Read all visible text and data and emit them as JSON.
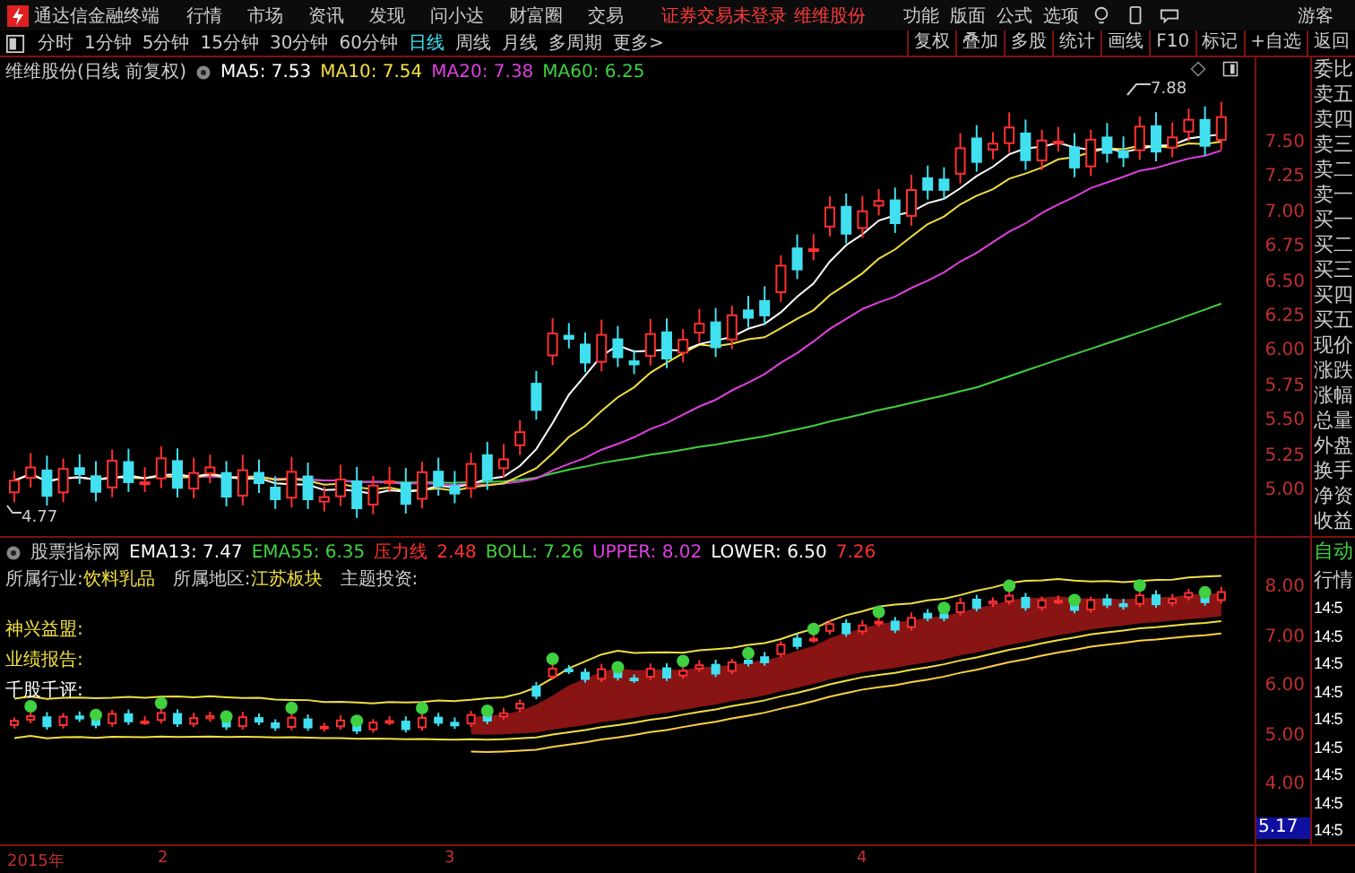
{
  "menu_bar": {
    "app_title": "通达信金融终端",
    "menus": [
      "行情",
      "市场",
      "资讯",
      "发现",
      "问小达",
      "财富圈",
      "交易"
    ],
    "login_status": "证券交易未登录",
    "account_name": "维维股份",
    "right_menus": [
      "功能",
      "版面",
      "公式",
      "选项"
    ],
    "user": "游客"
  },
  "period_tabs": [
    {
      "label": "分时",
      "selected": false
    },
    {
      "label": "1分钟",
      "selected": false
    },
    {
      "label": "5分钟",
      "selected": false
    },
    {
      "label": "15分钟",
      "selected": false
    },
    {
      "label": "30分钟",
      "selected": false
    },
    {
      "label": "60分钟",
      "selected": false
    },
    {
      "label": "日线",
      "selected": true
    },
    {
      "label": "周线",
      "selected": false
    },
    {
      "label": "月线",
      "selected": false
    },
    {
      "label": "多周期",
      "selected": false
    },
    {
      "label": "更多>",
      "selected": false
    }
  ],
  "tool_buttons": [
    "复权",
    "叠加",
    "多股",
    "统计",
    "画线",
    "F10",
    "标记",
    "+自选",
    "返回"
  ],
  "main_chart": {
    "title": "维维股份(日线 前复权)",
    "indicators": [
      {
        "text": "MA5: 7.53",
        "color": "#ffffff"
      },
      {
        "text": "MA10: 7.54",
        "color": "#f0e040"
      },
      {
        "text": "MA20: 7.38",
        "color": "#e040e0"
      },
      {
        "text": "MA60: 6.25",
        "color": "#40d040"
      }
    ],
    "price_ticks": [
      "7.50",
      "7.25",
      "7.00",
      "6.75",
      "6.50",
      "6.25",
      "6.00",
      "5.75",
      "5.50",
      "5.25",
      "5.00"
    ],
    "high_label": "7.88",
    "low_label": "4.77"
  },
  "indicator_pane": {
    "title": "股票指标网",
    "values": [
      {
        "text": "EMA13: 7.47",
        "color": "#ffffff"
      },
      {
        "text": "EMA55: 6.35",
        "color": "#40d040"
      },
      {
        "text": "压力线",
        "color": "#ff3030"
      },
      {
        "text": "2.48",
        "color": "#ff3030"
      },
      {
        "text": "BOLL: 7.26",
        "color": "#40d040"
      },
      {
        "text": "UPPER: 8.02",
        "color": "#e040e0"
      },
      {
        "text": "LOWER: 6.50",
        "color": "#ffffff"
      },
      {
        "text": "7.26",
        "color": "#ff3030"
      }
    ],
    "info": [
      {
        "label": "所属行业:",
        "value": "饮料乳品"
      },
      {
        "label": "所属地区:",
        "value": "江苏板块"
      },
      {
        "label": "主题投资:"
      }
    ],
    "notes": [
      {
        "text": "神兴益盟:",
        "color": "#f0e040"
      },
      {
        "text": "业绩报告:",
        "color": "#f0e040"
      },
      {
        "text": "千股千评:",
        "color": "#ffffff"
      }
    ],
    "ticks": [
      "8.00",
      "7.00",
      "6.00",
      "5.00",
      "4.00"
    ],
    "current_price": "5.17"
  },
  "date_axis": [
    "2015年",
    "2",
    "3",
    "4"
  ],
  "quote_panel": {
    "labels": [
      "委比",
      "卖五",
      "卖四",
      "卖三",
      "卖二",
      "卖一",
      "买一",
      "买二",
      "买三",
      "买四",
      "买五",
      "现价",
      "涨跌",
      "涨幅",
      "总量",
      "外盘",
      "换手",
      "净资",
      "收益"
    ],
    "mode_labels": [
      "自动",
      "行情"
    ],
    "times": [
      "14:5",
      "14:5",
      "14:5",
      "14:5",
      "14:5",
      "14:5",
      "14:5",
      "14:5",
      "14:5"
    ]
  }
}
